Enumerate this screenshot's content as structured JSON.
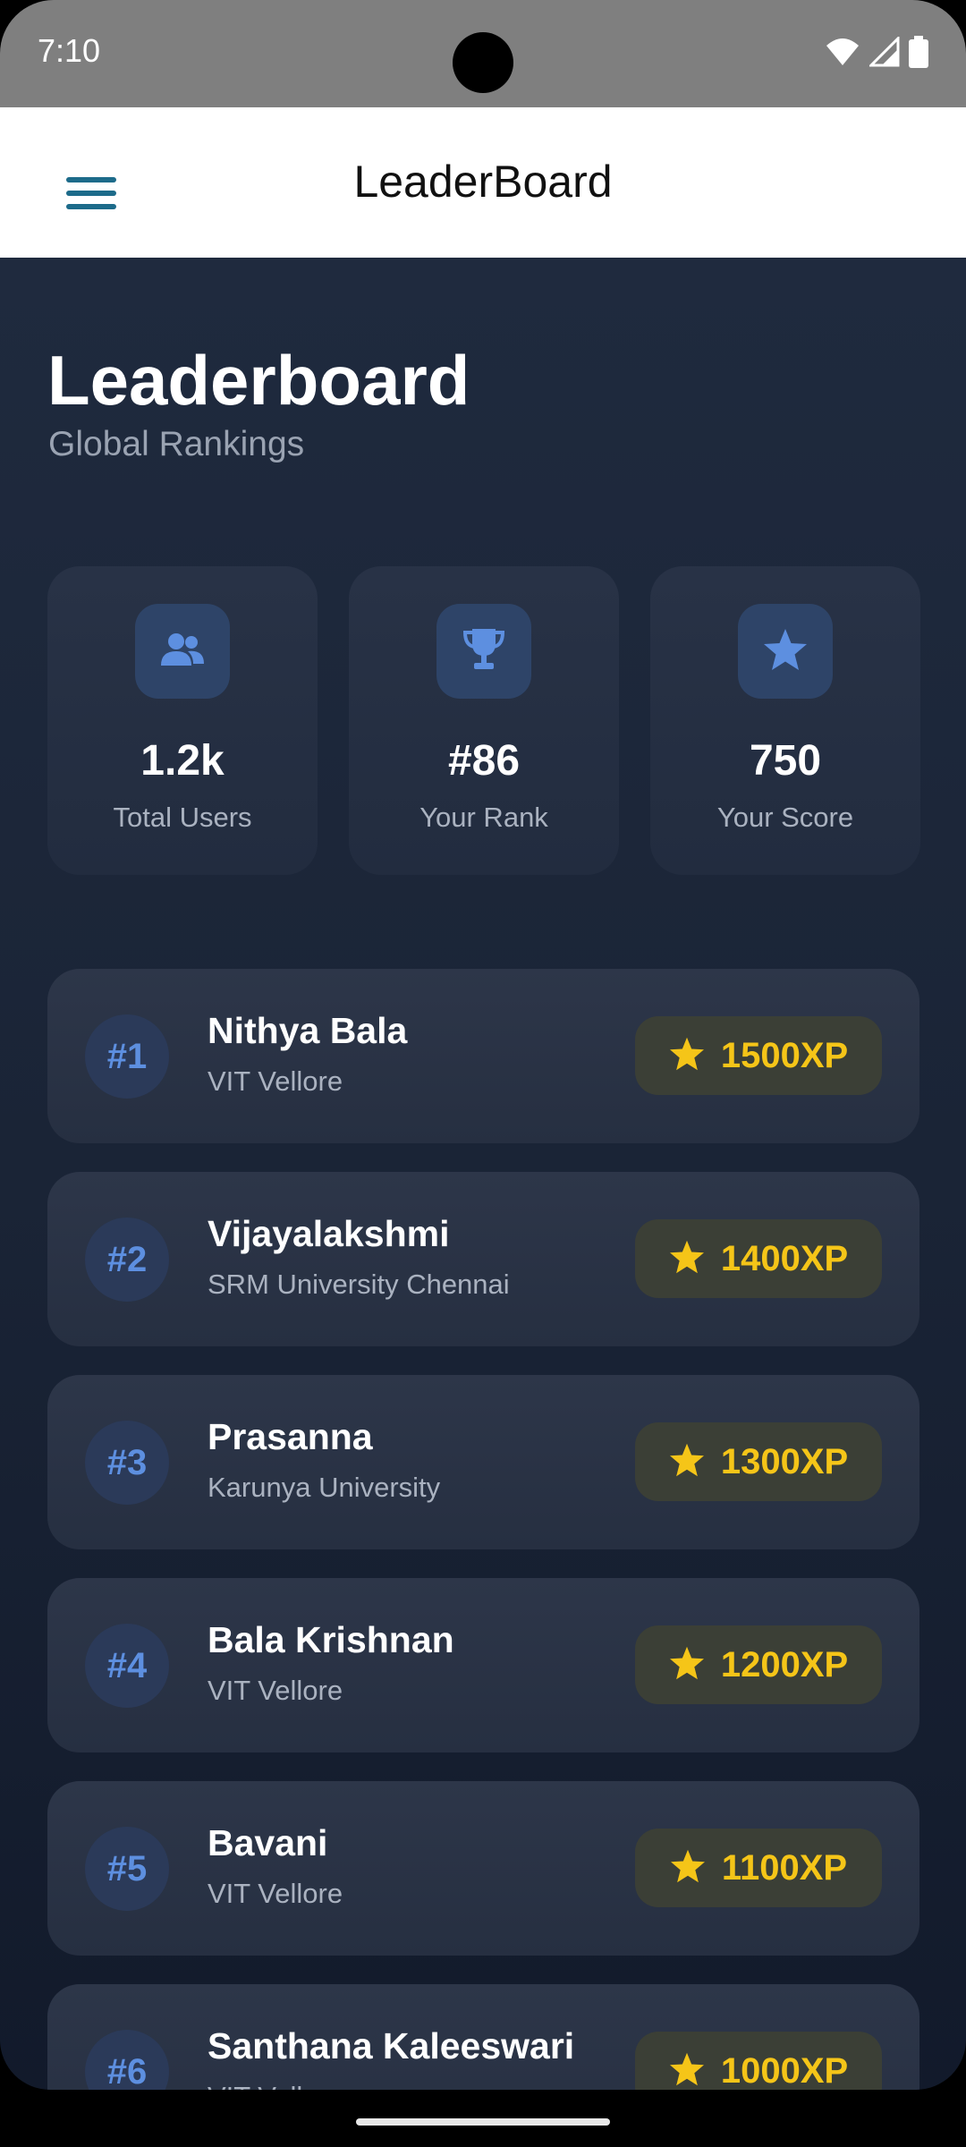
{
  "status_bar": {
    "time": "7:10"
  },
  "app_bar": {
    "title": "LeaderBoard",
    "menu_icon": "menu-icon"
  },
  "header": {
    "title": "Leaderboard",
    "subtitle": "Global Rankings"
  },
  "stats": [
    {
      "icon": "users-icon",
      "value": "1.2k",
      "label": "Total Users"
    },
    {
      "icon": "trophy-icon",
      "value": "#86",
      "label": "Your Rank"
    },
    {
      "icon": "star-icon",
      "value": "750",
      "label": "Your Score"
    }
  ],
  "leaderboard": [
    {
      "rank": "#1",
      "name": "Nithya Bala",
      "university": "VIT Vellore",
      "xp": "1500XP"
    },
    {
      "rank": "#2",
      "name": "Vijayalakshmi",
      "university": "SRM University Chennai",
      "xp": "1400XP"
    },
    {
      "rank": "#3",
      "name": "Prasanna",
      "university": "Karunya University",
      "xp": "1300XP"
    },
    {
      "rank": "#4",
      "name": "Bala Krishnan",
      "university": "VIT Vellore",
      "xp": "1200XP"
    },
    {
      "rank": "#5",
      "name": "Bavani",
      "university": "VIT Vellore",
      "xp": "1100XP"
    },
    {
      "rank": "#6",
      "name": "Santhana Kaleeswari",
      "university": "VIT Vellore",
      "xp": "1000XP"
    }
  ],
  "colors": {
    "accent": "#5d8fe0",
    "xp_gold": "#f5c518",
    "background": "#1f2a3e"
  }
}
